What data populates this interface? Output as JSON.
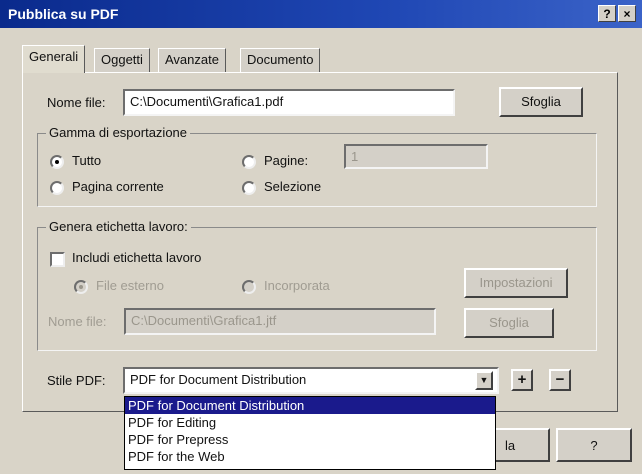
{
  "window": {
    "title": "Pubblica su PDF",
    "help_glyph": "?",
    "close_glyph": "×"
  },
  "tabs": [
    "Generali",
    "Oggetti",
    "Avanzate",
    "Documento"
  ],
  "nome_file": {
    "label": "Nome file:",
    "value": "C:\\Documenti\\Grafica1.pdf",
    "browse_label": "Sfoglia"
  },
  "gamma": {
    "title": "Gamma di esportazione",
    "tutto": "Tutto",
    "pagine": "Pagine:",
    "pagine_value": "1",
    "pagina_corrente": "Pagina corrente",
    "selezione": "Selezione",
    "selected": "Tutto"
  },
  "etichetta": {
    "title": "Genera etichetta lavoro:",
    "checkbox_label": "Includi etichetta lavoro",
    "checked": false,
    "file_esterno": "File esterno",
    "incorporata": "Incorporata",
    "impostazioni": "Impostazioni",
    "nome_file_label": "Nome file:",
    "nome_file_value": "C:\\Documenti\\Grafica1.jtf",
    "sfoglia": "Sfoglia"
  },
  "stile": {
    "label": "Stile PDF:",
    "value": "PDF for Document Distribution",
    "plus": "+",
    "minus": "−",
    "options": [
      "PDF for Document Distribution",
      "PDF for Editing",
      "PDF for Prepress",
      "PDF for the Web"
    ],
    "highlighted_index": 0,
    "arrow_glyph": "▼"
  },
  "bottom": {
    "btn_partial": "la",
    "help": "?"
  }
}
